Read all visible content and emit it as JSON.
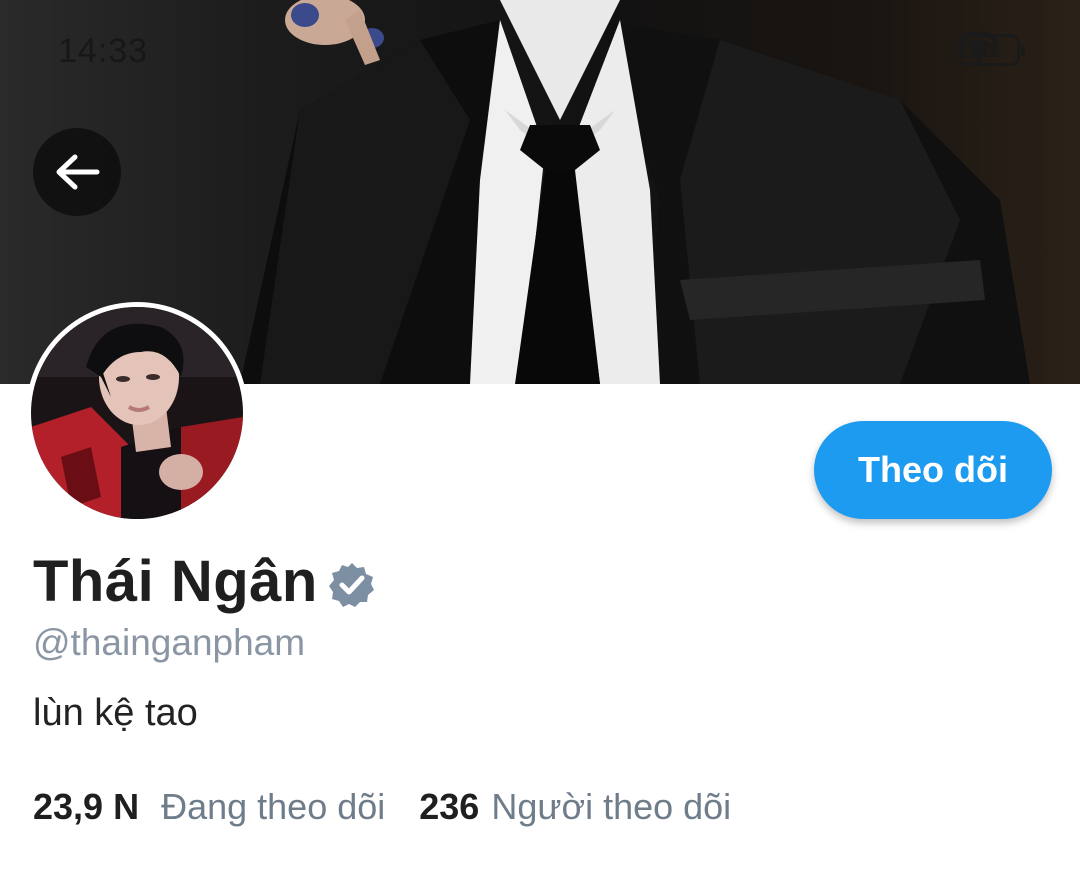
{
  "status_bar": {
    "time": "14:33",
    "battery_level": "54"
  },
  "profile": {
    "display_name": "Thái Ngân",
    "handle": "@thainganpham",
    "bio": "lùn kệ tao",
    "verified": true,
    "follow_button_label": "Theo dõi"
  },
  "stats": {
    "following_value": "23,9 N",
    "following_label": "Đang theo dõi",
    "followers_value": "236",
    "followers_label": "Người theo dõi"
  },
  "colors": {
    "accent": "#1d9bf0",
    "verified_badge": "#7d8fa3",
    "handle_text": "#8a96a3"
  }
}
